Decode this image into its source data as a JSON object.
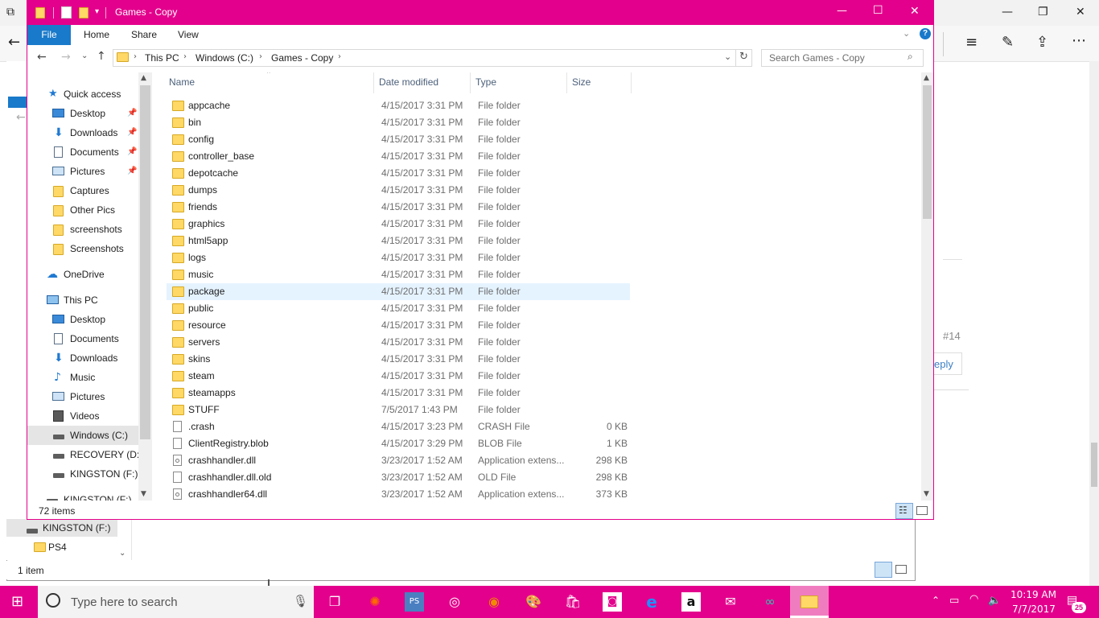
{
  "window": {
    "title": "Games - Copy",
    "minimize": "—",
    "maximize": "☐",
    "close": "✕"
  },
  "ribbon": {
    "tabs": [
      "File",
      "Home",
      "Share",
      "View"
    ],
    "help": "?"
  },
  "address": {
    "segments": [
      "This PC",
      "Windows (C:)",
      "Games - Copy"
    ],
    "search_placeholder": "Search Games - Copy"
  },
  "nav": {
    "items": [
      {
        "label": "Quick access",
        "icon": "star-icon",
        "indent": 0
      },
      {
        "label": "Desktop",
        "icon": "desktop-icon",
        "indent": 1,
        "pinned": true
      },
      {
        "label": "Downloads",
        "icon": "download-icon",
        "indent": 1,
        "pinned": true
      },
      {
        "label": "Documents",
        "icon": "document-icon",
        "indent": 1,
        "pinned": true
      },
      {
        "label": "Pictures",
        "icon": "pictures-icon",
        "indent": 1,
        "pinned": true
      },
      {
        "label": "Captures",
        "icon": "folder-icon",
        "indent": 1
      },
      {
        "label": "Other Pics",
        "icon": "folder-icon",
        "indent": 1
      },
      {
        "label": "screenshots",
        "icon": "folder-icon",
        "indent": 1
      },
      {
        "label": "Screenshots",
        "icon": "folder-icon",
        "indent": 1
      },
      {
        "label": "OneDrive",
        "icon": "cloud-icon",
        "indent": 0
      },
      {
        "label": "This PC",
        "icon": "computer-icon",
        "indent": 0
      },
      {
        "label": "Desktop",
        "icon": "desktop-icon",
        "indent": 1
      },
      {
        "label": "Documents",
        "icon": "document-icon",
        "indent": 1
      },
      {
        "label": "Downloads",
        "icon": "download-icon",
        "indent": 1
      },
      {
        "label": "Music",
        "icon": "music-icon",
        "indent": 1
      },
      {
        "label": "Pictures",
        "icon": "pictures-icon",
        "indent": 1
      },
      {
        "label": "Videos",
        "icon": "video-icon",
        "indent": 1
      },
      {
        "label": "Windows (C:)",
        "icon": "drive-icon",
        "indent": 1,
        "selected": true
      },
      {
        "label": "RECOVERY (D:)",
        "icon": "drive-icon",
        "indent": 1
      },
      {
        "label": "KINGSTON (F:)",
        "icon": "drive-icon",
        "indent": 1
      },
      {
        "label": "KINGSTON (F:)",
        "icon": "drive-icon",
        "indent": 0
      }
    ]
  },
  "columns": {
    "name": "Name",
    "date": "Date modified",
    "type": "Type",
    "size": "Size"
  },
  "files": [
    {
      "name": "appcache",
      "date": "4/15/2017 3:31 PM",
      "type": "File folder",
      "size": "",
      "icon": "folder"
    },
    {
      "name": "bin",
      "date": "4/15/2017 3:31 PM",
      "type": "File folder",
      "size": "",
      "icon": "folder"
    },
    {
      "name": "config",
      "date": "4/15/2017 3:31 PM",
      "type": "File folder",
      "size": "",
      "icon": "folder"
    },
    {
      "name": "controller_base",
      "date": "4/15/2017 3:31 PM",
      "type": "File folder",
      "size": "",
      "icon": "folder"
    },
    {
      "name": "depotcache",
      "date": "4/15/2017 3:31 PM",
      "type": "File folder",
      "size": "",
      "icon": "folder"
    },
    {
      "name": "dumps",
      "date": "4/15/2017 3:31 PM",
      "type": "File folder",
      "size": "",
      "icon": "folder"
    },
    {
      "name": "friends",
      "date": "4/15/2017 3:31 PM",
      "type": "File folder",
      "size": "",
      "icon": "folder"
    },
    {
      "name": "graphics",
      "date": "4/15/2017 3:31 PM",
      "type": "File folder",
      "size": "",
      "icon": "folder"
    },
    {
      "name": "html5app",
      "date": "4/15/2017 3:31 PM",
      "type": "File folder",
      "size": "",
      "icon": "folder"
    },
    {
      "name": "logs",
      "date": "4/15/2017 3:31 PM",
      "type": "File folder",
      "size": "",
      "icon": "folder"
    },
    {
      "name": "music",
      "date": "4/15/2017 3:31 PM",
      "type": "File folder",
      "size": "",
      "icon": "folder"
    },
    {
      "name": "package",
      "date": "4/15/2017 3:31 PM",
      "type": "File folder",
      "size": "",
      "icon": "folder",
      "hover": true
    },
    {
      "name": "public",
      "date": "4/15/2017 3:31 PM",
      "type": "File folder",
      "size": "",
      "icon": "folder"
    },
    {
      "name": "resource",
      "date": "4/15/2017 3:31 PM",
      "type": "File folder",
      "size": "",
      "icon": "folder"
    },
    {
      "name": "servers",
      "date": "4/15/2017 3:31 PM",
      "type": "File folder",
      "size": "",
      "icon": "folder"
    },
    {
      "name": "skins",
      "date": "4/15/2017 3:31 PM",
      "type": "File folder",
      "size": "",
      "icon": "folder"
    },
    {
      "name": "steam",
      "date": "4/15/2017 3:31 PM",
      "type": "File folder",
      "size": "",
      "icon": "folder"
    },
    {
      "name": "steamapps",
      "date": "4/15/2017 3:31 PM",
      "type": "File folder",
      "size": "",
      "icon": "folder"
    },
    {
      "name": "STUFF",
      "date": "7/5/2017 1:43 PM",
      "type": "File folder",
      "size": "",
      "icon": "folder"
    },
    {
      "name": ".crash",
      "date": "4/15/2017 3:23 PM",
      "type": "CRASH File",
      "size": "0 KB",
      "icon": "file"
    },
    {
      "name": "ClientRegistry.blob",
      "date": "4/15/2017 3:29 PM",
      "type": "BLOB File",
      "size": "1 KB",
      "icon": "file"
    },
    {
      "name": "crashhandler.dll",
      "date": "3/23/2017 1:52 AM",
      "type": "Application extens...",
      "size": "298 KB",
      "icon": "dll"
    },
    {
      "name": "crashhandler.dll.old",
      "date": "3/23/2017 1:52 AM",
      "type": "OLD File",
      "size": "298 KB",
      "icon": "file"
    },
    {
      "name": "crashhandler64.dll",
      "date": "3/23/2017 1:52 AM",
      "type": "Application extens...",
      "size": "373 KB",
      "icon": "dll"
    }
  ],
  "status": {
    "items": "72 items"
  },
  "behind": {
    "nav_drive": "KINGSTON (F:)",
    "nav_folder": "PS4",
    "status": "1 item",
    "post_number": "#14",
    "reply": "eply"
  },
  "taskbar": {
    "search_placeholder": "Type here to search",
    "time": "10:19 AM",
    "date": "7/7/2017",
    "notifications": "25"
  },
  "colors": {
    "accent": "#e3008c",
    "file_tab": "#1979ca",
    "folder": "#ffd866",
    "hover_row": "#e5f3ff"
  }
}
